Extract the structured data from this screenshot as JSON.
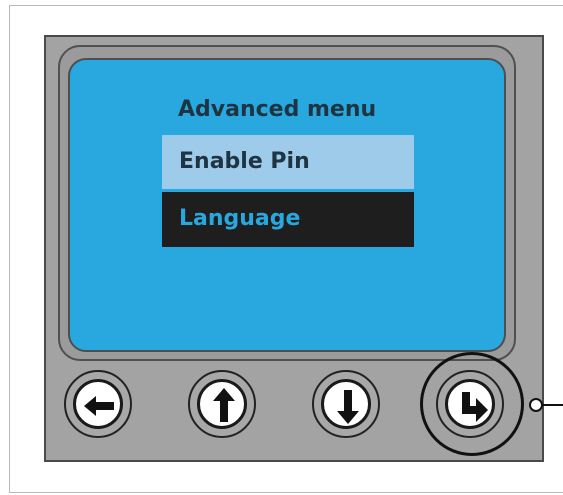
{
  "screen": {
    "title": "Advanced menu",
    "items": [
      {
        "label": "Enable Pin",
        "highlighted": false
      },
      {
        "label": "Language",
        "highlighted": true
      }
    ],
    "colors": {
      "background": "#29a8df",
      "title_text": "#1f3441",
      "item_highlight_bg": "#9fcbea",
      "item_selected_bg": "#1e1e1e",
      "item_selected_text": "#29a8df"
    }
  },
  "buttons": [
    {
      "name": "back",
      "icon": "arrow-left-icon"
    },
    {
      "name": "up",
      "icon": "arrow-up-icon"
    },
    {
      "name": "down",
      "icon": "arrow-down-icon"
    },
    {
      "name": "enter",
      "icon": "enter-arrow-icon",
      "callout": true
    }
  ]
}
